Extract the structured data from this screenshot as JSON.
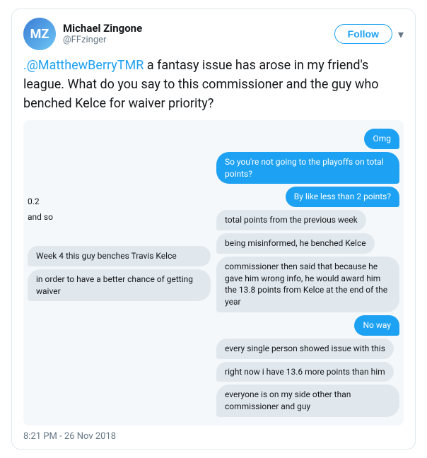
{
  "header": {
    "display_name": "Michael Zingone",
    "handle": "@FFzinger",
    "follow_label": "Follow",
    "chevron": "▾"
  },
  "tweet": {
    "text_parts": [
      {
        "type": "mention",
        "text": ".@MatthewBerryTMR"
      },
      {
        "type": "text",
        "text": " a fantasy issue has arose in my friend's league. What do you say to this commissioner and the guy who benched Kelce for waiver priority?"
      }
    ]
  },
  "chat": {
    "right_bubbles": [
      {
        "id": "r1",
        "text": "Omg"
      },
      {
        "id": "r2",
        "text": "So you're not going to the playoffs on total points?"
      },
      {
        "id": "r3",
        "text": "By like less than 2 points?"
      }
    ],
    "left_labels": [
      {
        "id": "l1",
        "text": "0.2"
      },
      {
        "id": "l2",
        "text": "and so"
      }
    ],
    "right_bubble2": {
      "id": "r4",
      "text": "No way"
    },
    "left_bubbles": [
      {
        "id": "lb1",
        "text": "Week 4 this guy benches Travis Kelce"
      },
      {
        "id": "lb2",
        "text": "in order to have a better chance of getting waiver"
      }
    ],
    "right_text_bubbles": [
      {
        "id": "rt1",
        "text": "total points from the previous week"
      },
      {
        "id": "rt2",
        "text": "being misinformed, he benched Kelce"
      },
      {
        "id": "rt3",
        "text": "commissioner then said that because he gave him wrong info, he would award him the 13.8 points from Kelce at the end of the year"
      },
      {
        "id": "rt4",
        "text": "every single person showed issue with this"
      },
      {
        "id": "rt5",
        "text": "right now i have 13.6 more points than him"
      },
      {
        "id": "rt6",
        "text": "everyone is on my side other than commissioner and guy"
      }
    ]
  },
  "footer": {
    "timestamp": "8:21 PM - 26 Nov 2018"
  }
}
